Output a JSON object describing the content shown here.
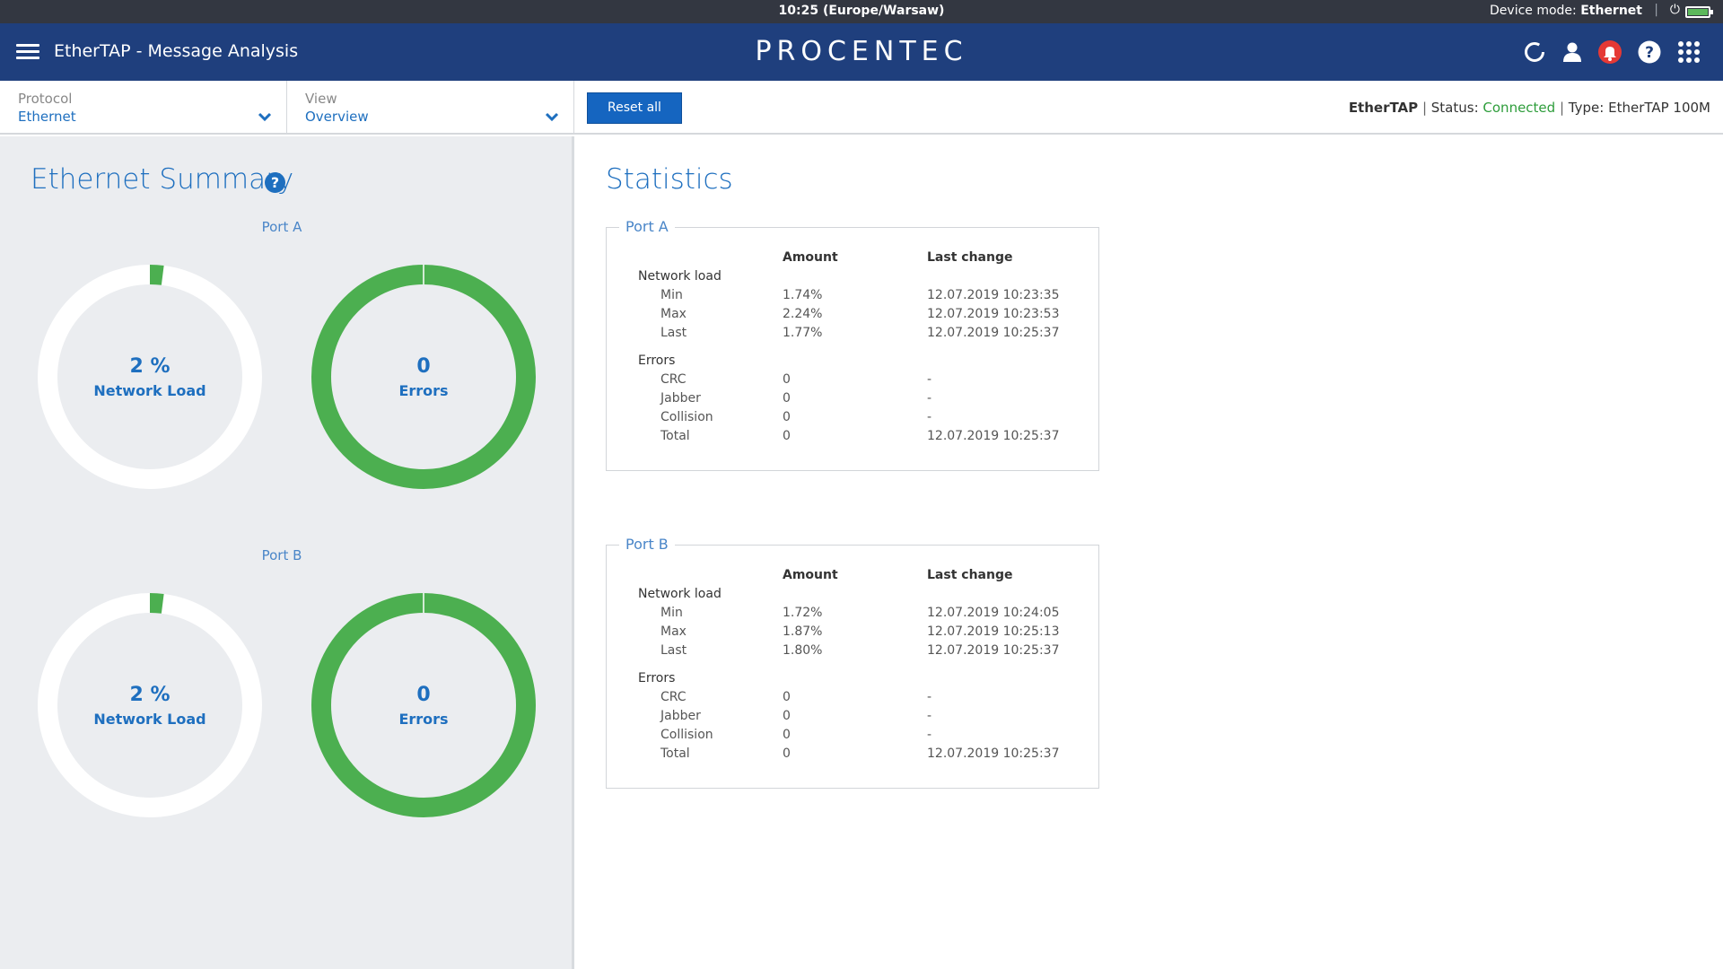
{
  "status_bar": {
    "clock": "10:25 (Europe/Warsaw)",
    "device_mode_label": "Device mode:",
    "device_mode_value": "Ethernet",
    "battery_color": "#5cb85c"
  },
  "header": {
    "app_title": "EtherTAP - Message Analysis",
    "logo": "PROCENTEC",
    "background_color": "#1f3f7d",
    "icons": [
      "refresh-icon",
      "user-icon",
      "notification-bell-icon",
      "help-icon",
      "apps-grid-icon"
    ],
    "alert_color": "#e53935"
  },
  "toolbar": {
    "protocol": {
      "label": "Protocol",
      "value": "Ethernet"
    },
    "view": {
      "label": "View",
      "value": "Overview"
    },
    "reset_label": "Reset all",
    "device": {
      "name": "EtherTAP",
      "status_label": "Status:",
      "status_value": "Connected",
      "type_label": "Type:",
      "type_value": "EtherTAP 100M"
    }
  },
  "summary": {
    "title": "Ethernet Summary",
    "help": "?",
    "ports": [
      {
        "label": "Port A",
        "load": {
          "value": "2 %",
          "label": "Network Load",
          "fraction": 0.02
        },
        "errors": {
          "value": "0",
          "label": "Errors",
          "fraction": 1.0
        }
      },
      {
        "label": "Port B",
        "load": {
          "value": "2 %",
          "label": "Network Load",
          "fraction": 0.02
        },
        "errors": {
          "value": "0",
          "label": "Errors",
          "fraction": 1.0
        }
      }
    ],
    "ring_color": "#4caf50"
  },
  "statistics": {
    "title": "Statistics",
    "col_amount": "Amount",
    "col_last_change": "Last change",
    "ports": [
      {
        "legend": "Port A",
        "sections": [
          {
            "name": "Network load",
            "rows": [
              {
                "label": "Min",
                "amount": "1.74%",
                "last_change": "12.07.2019 10:23:35"
              },
              {
                "label": "Max",
                "amount": "2.24%",
                "last_change": "12.07.2019 10:23:53"
              },
              {
                "label": "Last",
                "amount": "1.77%",
                "last_change": "12.07.2019 10:25:37"
              }
            ]
          },
          {
            "name": "Errors",
            "rows": [
              {
                "label": "CRC",
                "amount": "0",
                "last_change": "-"
              },
              {
                "label": "Jabber",
                "amount": "0",
                "last_change": "-"
              },
              {
                "label": "Collision",
                "amount": "0",
                "last_change": "-"
              },
              {
                "label": "Total",
                "amount": "0",
                "last_change": "12.07.2019 10:25:37"
              }
            ]
          }
        ]
      },
      {
        "legend": "Port B",
        "sections": [
          {
            "name": "Network load",
            "rows": [
              {
                "label": "Min",
                "amount": "1.72%",
                "last_change": "12.07.2019 10:24:05"
              },
              {
                "label": "Max",
                "amount": "1.87%",
                "last_change": "12.07.2019 10:25:13"
              },
              {
                "label": "Last",
                "amount": "1.80%",
                "last_change": "12.07.2019 10:25:37"
              }
            ]
          },
          {
            "name": "Errors",
            "rows": [
              {
                "label": "CRC",
                "amount": "0",
                "last_change": "-"
              },
              {
                "label": "Jabber",
                "amount": "0",
                "last_change": "-"
              },
              {
                "label": "Collision",
                "amount": "0",
                "last_change": "-"
              },
              {
                "label": "Total",
                "amount": "0",
                "last_change": "12.07.2019 10:25:37"
              }
            ]
          }
        ]
      }
    ]
  }
}
